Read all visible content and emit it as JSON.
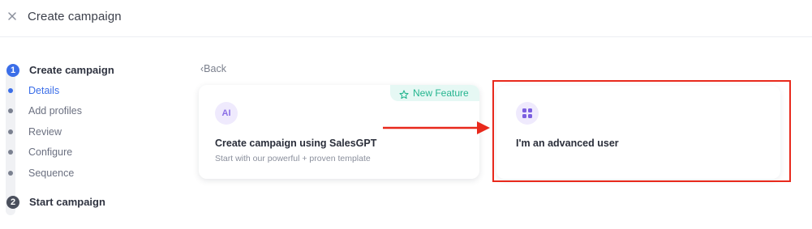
{
  "header": {
    "title": "Create campaign",
    "close_icon": "close-icon"
  },
  "stepper": {
    "steps": [
      {
        "number": "1",
        "title": "Create campaign",
        "state": "active"
      },
      {
        "number": "2",
        "title": "Start campaign",
        "state": "inactive"
      }
    ],
    "substeps": [
      {
        "label": "Details",
        "state": "active"
      },
      {
        "label": "Add profiles",
        "state": "inactive"
      },
      {
        "label": "Review",
        "state": "inactive"
      },
      {
        "label": "Configure",
        "state": "inactive"
      },
      {
        "label": "Sequence",
        "state": "inactive"
      }
    ]
  },
  "back": {
    "label": "Back"
  },
  "cards": {
    "salesgpt": {
      "badge": "AI",
      "tag": "New Feature",
      "title": "Create campaign using SalesGPT",
      "subtitle": "Start with our powerful + proven template"
    },
    "advanced": {
      "icon": "grid-icon",
      "title": "I'm an advanced user"
    }
  },
  "colors": {
    "accent": "#3b6ee8",
    "highlight": "#e8291c",
    "new_feature": "#25b58f",
    "badge_bg": "#efeafd"
  }
}
